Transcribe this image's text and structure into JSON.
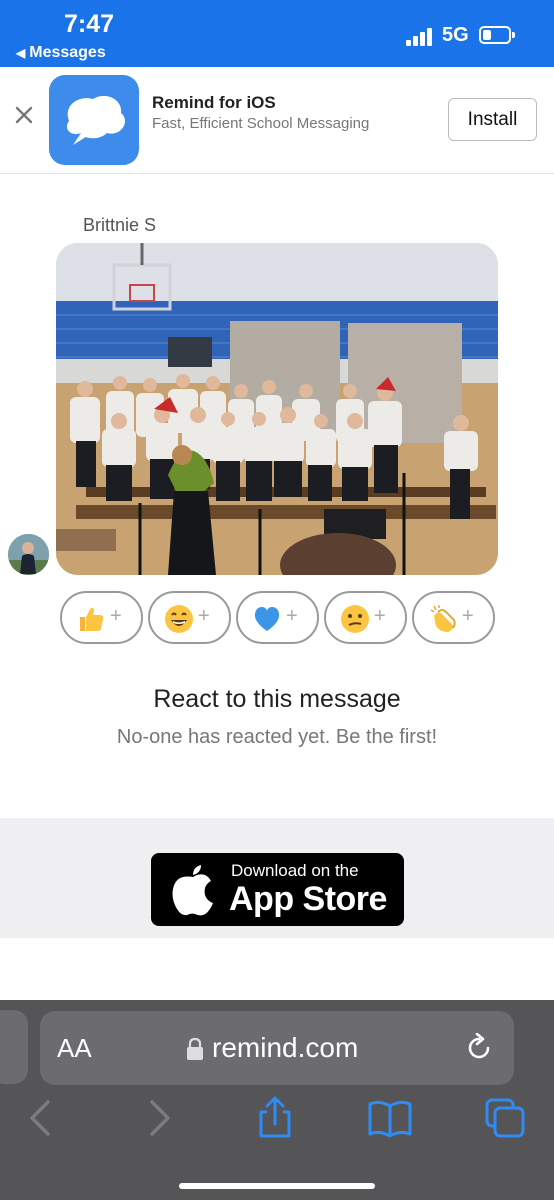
{
  "status_bar": {
    "time": "7:47",
    "back_label": "Messages",
    "network": "5G"
  },
  "app_banner": {
    "app_name": "Remind for iOS",
    "subtitle": "Fast, Efficient School Messaging",
    "install_label": "Install"
  },
  "message": {
    "sender": "Brittnie S"
  },
  "reactions": {
    "items": [
      {
        "icon": "thumbs-up-icon",
        "plus": "+"
      },
      {
        "icon": "grinning-face-icon",
        "plus": "+"
      },
      {
        "icon": "blue-heart-icon",
        "plus": "+"
      },
      {
        "icon": "confused-face-icon",
        "plus": "+"
      },
      {
        "icon": "clapping-hands-icon",
        "plus": "+"
      }
    ],
    "title": "React to this message",
    "subtitle": "No-one has reacted yet. Be the first!"
  },
  "app_store": {
    "small_text": "Download on the",
    "big_text": "App Store"
  },
  "browser": {
    "aa_label": "AA",
    "domain": "remind.com"
  },
  "colors": {
    "status_blue": "#1a73e8",
    "remind_blue": "#3d8bea",
    "browser_gray": "#555557"
  }
}
